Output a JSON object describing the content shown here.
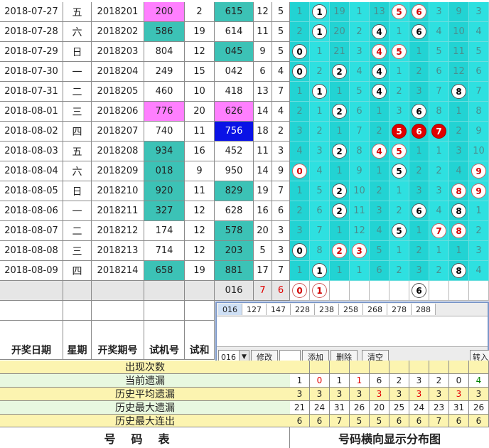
{
  "rows": [
    {
      "date": "2018-07-27",
      "week": "五",
      "issue": "2018201",
      "test": "200",
      "test_bg": "pink",
      "tsum": "2",
      "open": "615",
      "open_bg": "teal",
      "s": "12",
      "k": "5",
      "dist": [
        {
          "t": "1"
        },
        {
          "t": "1",
          "b": "w"
        },
        {
          "t": "19"
        },
        {
          "t": "1"
        },
        {
          "t": "13"
        },
        {
          "t": "5",
          "b": "r"
        },
        {
          "t": "6",
          "b": "r"
        },
        {
          "t": "3"
        },
        {
          "t": "9"
        },
        {
          "t": "3"
        }
      ]
    },
    {
      "date": "2018-07-28",
      "week": "六",
      "issue": "2018202",
      "test": "586",
      "test_bg": "teal",
      "tsum": "19",
      "open": "614",
      "open_bg": "",
      "s": "11",
      "k": "5",
      "dist": [
        {
          "t": "2"
        },
        {
          "t": "1",
          "b": "w"
        },
        {
          "t": "20"
        },
        {
          "t": "2"
        },
        {
          "t": "4",
          "b": "w"
        },
        {
          "t": "1"
        },
        {
          "t": "6",
          "b": "w"
        },
        {
          "t": "4"
        },
        {
          "t": "10"
        },
        {
          "t": "4"
        }
      ]
    },
    {
      "date": "2018-07-29",
      "week": "日",
      "issue": "2018203",
      "test": "804",
      "test_bg": "",
      "tsum": "12",
      "open": "045",
      "open_bg": "teal",
      "s": "9",
      "k": "5",
      "dist": [
        {
          "t": "0",
          "b": "w"
        },
        {
          "t": "1"
        },
        {
          "t": "21"
        },
        {
          "t": "3"
        },
        {
          "t": "4",
          "b": "r"
        },
        {
          "t": "5",
          "b": "r"
        },
        {
          "t": "1"
        },
        {
          "t": "5"
        },
        {
          "t": "11"
        },
        {
          "t": "5"
        }
      ]
    },
    {
      "date": "2018-07-30",
      "week": "一",
      "issue": "2018204",
      "test": "249",
      "test_bg": "",
      "tsum": "15",
      "open": "042",
      "open_bg": "",
      "s": "6",
      "k": "4",
      "dist": [
        {
          "t": "0",
          "b": "w"
        },
        {
          "t": "2"
        },
        {
          "t": "2",
          "b": "w"
        },
        {
          "t": "4"
        },
        {
          "t": "4",
          "b": "w"
        },
        {
          "t": "1"
        },
        {
          "t": "2"
        },
        {
          "t": "6"
        },
        {
          "t": "12"
        },
        {
          "t": "6"
        }
      ]
    },
    {
      "date": "2018-07-31",
      "week": "二",
      "issue": "2018205",
      "test": "460",
      "test_bg": "",
      "tsum": "10",
      "open": "418",
      "open_bg": "",
      "s": "13",
      "k": "7",
      "dist": [
        {
          "t": "1"
        },
        {
          "t": "1",
          "b": "w"
        },
        {
          "t": "1"
        },
        {
          "t": "5"
        },
        {
          "t": "4",
          "b": "w"
        },
        {
          "t": "2"
        },
        {
          "t": "3"
        },
        {
          "t": "7"
        },
        {
          "t": "8",
          "b": "w"
        },
        {
          "t": "7"
        }
      ]
    },
    {
      "date": "2018-08-01",
      "week": "三",
      "issue": "2018206",
      "test": "776",
      "test_bg": "pink",
      "tsum": "20",
      "open": "626",
      "open_bg": "pink",
      "s": "14",
      "k": "4",
      "dist": [
        {
          "t": "2"
        },
        {
          "t": "1"
        },
        {
          "t": "2",
          "b": "w"
        },
        {
          "t": "6"
        },
        {
          "t": "1"
        },
        {
          "t": "3"
        },
        {
          "t": "6",
          "b": "w"
        },
        {
          "t": "8"
        },
        {
          "t": "1"
        },
        {
          "t": "8"
        }
      ]
    },
    {
      "date": "2018-08-02",
      "week": "四",
      "issue": "2018207",
      "test": "740",
      "test_bg": "",
      "tsum": "11",
      "open": "756",
      "open_bg": "blue",
      "s": "18",
      "k": "2",
      "dist": [
        {
          "t": "3"
        },
        {
          "t": "2"
        },
        {
          "t": "1"
        },
        {
          "t": "7"
        },
        {
          "t": "2"
        },
        {
          "t": "5",
          "b": "R"
        },
        {
          "t": "6",
          "b": "R"
        },
        {
          "t": "7",
          "b": "R"
        },
        {
          "t": "2"
        },
        {
          "t": "9"
        }
      ]
    },
    {
      "date": "2018-08-03",
      "week": "五",
      "issue": "2018208",
      "test": "934",
      "test_bg": "teal",
      "tsum": "16",
      "open": "452",
      "open_bg": "",
      "s": "11",
      "k": "3",
      "dist": [
        {
          "t": "4"
        },
        {
          "t": "3"
        },
        {
          "t": "2",
          "b": "w"
        },
        {
          "t": "8"
        },
        {
          "t": "4",
          "b": "r"
        },
        {
          "t": "5",
          "b": "r"
        },
        {
          "t": "1"
        },
        {
          "t": "1"
        },
        {
          "t": "3"
        },
        {
          "t": "10"
        }
      ]
    },
    {
      "date": "2018-08-04",
      "week": "六",
      "issue": "2018209",
      "test": "018",
      "test_bg": "teal",
      "tsum": "9",
      "open": "950",
      "open_bg": "",
      "s": "14",
      "k": "9",
      "dist": [
        {
          "t": "0",
          "b": "r"
        },
        {
          "t": "4"
        },
        {
          "t": "1"
        },
        {
          "t": "9"
        },
        {
          "t": "1"
        },
        {
          "t": "5",
          "b": "w"
        },
        {
          "t": "2"
        },
        {
          "t": "2"
        },
        {
          "t": "4"
        },
        {
          "t": "9",
          "b": "r"
        }
      ]
    },
    {
      "date": "2018-08-05",
      "week": "日",
      "issue": "2018210",
      "test": "920",
      "test_bg": "teal",
      "tsum": "11",
      "open": "829",
      "open_bg": "teal",
      "s": "19",
      "k": "7",
      "dist": [
        {
          "t": "1"
        },
        {
          "t": "5"
        },
        {
          "t": "2",
          "b": "w"
        },
        {
          "t": "10"
        },
        {
          "t": "2"
        },
        {
          "t": "1"
        },
        {
          "t": "3"
        },
        {
          "t": "3"
        },
        {
          "t": "8",
          "b": "r"
        },
        {
          "t": "9",
          "b": "r"
        }
      ]
    },
    {
      "date": "2018-08-06",
      "week": "一",
      "issue": "2018211",
      "test": "327",
      "test_bg": "teal",
      "tsum": "12",
      "open": "628",
      "open_bg": "",
      "s": "16",
      "k": "6",
      "dist": [
        {
          "t": "2"
        },
        {
          "t": "6"
        },
        {
          "t": "2",
          "b": "w"
        },
        {
          "t": "11"
        },
        {
          "t": "3"
        },
        {
          "t": "2"
        },
        {
          "t": "6",
          "b": "w"
        },
        {
          "t": "4"
        },
        {
          "t": "8",
          "b": "w"
        },
        {
          "t": "1"
        }
      ]
    },
    {
      "date": "2018-08-07",
      "week": "二",
      "issue": "2018212",
      "test": "174",
      "test_bg": "",
      "tsum": "12",
      "open": "578",
      "open_bg": "teal",
      "s": "20",
      "k": "3",
      "dist": [
        {
          "t": "3"
        },
        {
          "t": "7"
        },
        {
          "t": "1"
        },
        {
          "t": "12"
        },
        {
          "t": "4"
        },
        {
          "t": "5",
          "b": "w"
        },
        {
          "t": "1"
        },
        {
          "t": "7",
          "b": "r"
        },
        {
          "t": "8",
          "b": "r"
        },
        {
          "t": "2"
        }
      ]
    },
    {
      "date": "2018-08-08",
      "week": "三",
      "issue": "2018213",
      "test": "714",
      "test_bg": "",
      "tsum": "12",
      "open": "203",
      "open_bg": "teal",
      "s": "5",
      "k": "3",
      "dist": [
        {
          "t": "0",
          "b": "w"
        },
        {
          "t": "8"
        },
        {
          "t": "2",
          "b": "r"
        },
        {
          "t": "3",
          "b": "r"
        },
        {
          "t": "5"
        },
        {
          "t": "1"
        },
        {
          "t": "2"
        },
        {
          "t": "1"
        },
        {
          "t": "1"
        },
        {
          "t": "3"
        }
      ]
    },
    {
      "date": "2018-08-09",
      "week": "四",
      "issue": "2018214",
      "test": "658",
      "test_bg": "teal",
      "tsum": "19",
      "open": "881",
      "open_bg": "teal",
      "s": "17",
      "k": "7",
      "dist": [
        {
          "t": "1"
        },
        {
          "t": "1",
          "b": "w"
        },
        {
          "t": "1"
        },
        {
          "t": "1"
        },
        {
          "t": "6"
        },
        {
          "t": "2"
        },
        {
          "t": "3"
        },
        {
          "t": "2"
        },
        {
          "t": "8",
          "b": "w"
        },
        {
          "t": "4"
        }
      ]
    }
  ],
  "pending_row": {
    "open": "016",
    "s": "7",
    "k": "6",
    "dist": [
      {
        "t": "0",
        "b": "r"
      },
      {
        "t": "1",
        "b": "r"
      },
      {
        "t": ""
      },
      {
        "t": ""
      },
      {
        "t": ""
      },
      {
        "t": ""
      },
      {
        "t": "6",
        "b": "w"
      },
      {
        "t": ""
      },
      {
        "t": ""
      },
      {
        "t": ""
      }
    ]
  },
  "popup": {
    "chips": [
      "016",
      "127",
      "147",
      "228",
      "238",
      "258",
      "268",
      "278",
      "288"
    ],
    "select_value": "016",
    "buttons": {
      "modify": "修改",
      "add": "添加",
      "delete": "删除",
      "clear": "清空",
      "import": "转入"
    }
  },
  "header": {
    "date": "开奖日期",
    "week": "星期",
    "issue": "开奖期号",
    "test": "试机号",
    "tsum": "试和"
  },
  "stats": [
    {
      "label": "出现次数",
      "values": []
    },
    {
      "label": "当前遗漏",
      "values": [
        "1",
        "0",
        "1",
        "1",
        "6",
        "2",
        "3",
        "2",
        "0",
        "4"
      ],
      "colors": [
        "",
        "r",
        "",
        "r",
        "",
        "",
        "",
        "",
        "",
        "g"
      ]
    },
    {
      "label": "历史平均遗漏",
      "values": [
        "3",
        "3",
        "3",
        "3",
        "3",
        "3",
        "3",
        "3",
        "3",
        "3"
      ],
      "colors": [
        "",
        "",
        "",
        "",
        "r",
        "",
        "r",
        "",
        "r",
        ""
      ]
    },
    {
      "label": "历史最大遗漏",
      "values": [
        "21",
        "24",
        "31",
        "26",
        "20",
        "25",
        "24",
        "23",
        "31",
        "26"
      ]
    },
    {
      "label": "历史最大连出",
      "values": [
        "6",
        "6",
        "7",
        "5",
        "5",
        "6",
        "6",
        "7",
        "6",
        "6"
      ]
    }
  ],
  "colors": {
    "pink": "#ff7fff",
    "teal": "#3cc2b6",
    "blue": "#0a12e6",
    "cyan": "#22d3d3",
    "yellow": "#fcf4b0",
    "green_stat": "#a8eea8"
  },
  "footer": {
    "left": "号码表",
    "right": "号码横向显示分布图"
  }
}
